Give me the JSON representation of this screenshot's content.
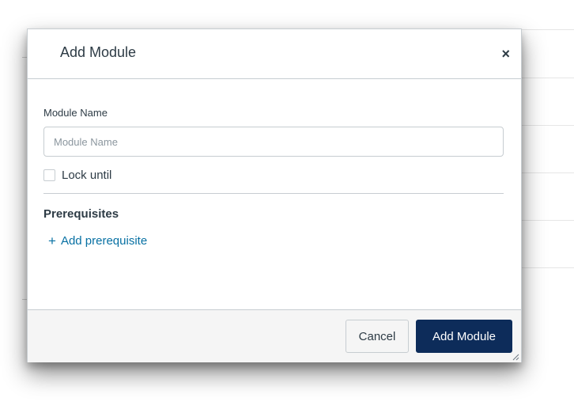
{
  "dialog": {
    "title": "Add Module",
    "close_glyph": "×",
    "close_icon": "close-icon"
  },
  "form": {
    "name_label": "Module Name",
    "name_placeholder": "Module Name",
    "name_value": "",
    "lock_label": "Lock until",
    "lock_checked": false
  },
  "prerequisites": {
    "heading": "Prerequisites",
    "add_glyph": "+",
    "add_icon": "plus-icon",
    "add_label": "Add prerequisite"
  },
  "footer": {
    "cancel_label": "Cancel",
    "submit_label": "Add Module",
    "resize_icon": "resize-grip-icon"
  },
  "colors": {
    "primary_button": "#0d2c5a",
    "link": "#0770a3",
    "text": "#2d3b45",
    "border": "#c7cdd1",
    "footer_bg": "#f5f5f5"
  }
}
